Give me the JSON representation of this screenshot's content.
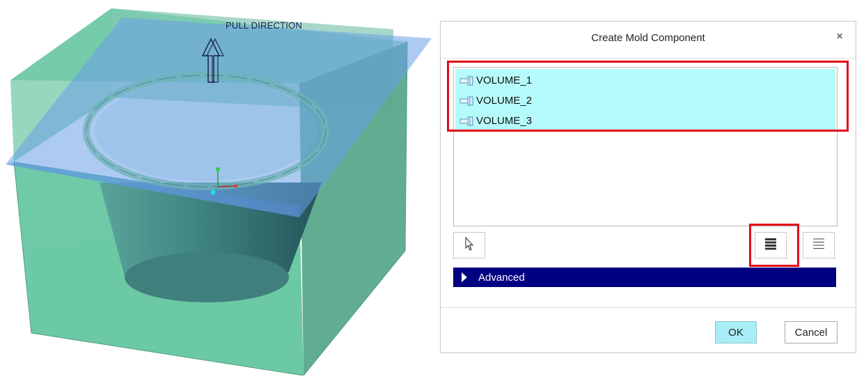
{
  "viewport": {
    "pull_direction_label": "PULL DIRECTION"
  },
  "dialog": {
    "title": "Create Mold Component",
    "close_icon": "close-icon",
    "list": {
      "items": [
        {
          "label": "VOLUME_1",
          "icon": "volume-icon",
          "selected": true
        },
        {
          "label": "VOLUME_2",
          "icon": "volume-icon",
          "selected": true
        },
        {
          "label": "VOLUME_3",
          "icon": "volume-icon",
          "selected": true
        }
      ]
    },
    "toolbar": {
      "select_icon": "cursor-arrow-icon",
      "select_all_icon": "select-all-icon",
      "deselect_all_icon": "deselect-all-icon"
    },
    "advanced_label": "Advanced",
    "ok_label": "OK",
    "cancel_label": "Cancel"
  },
  "colors": {
    "selection": "#b6fbfb",
    "highlight_frame": "#e30b17",
    "advanced_bar": "#000080",
    "ok_button": "#a9eef6"
  }
}
